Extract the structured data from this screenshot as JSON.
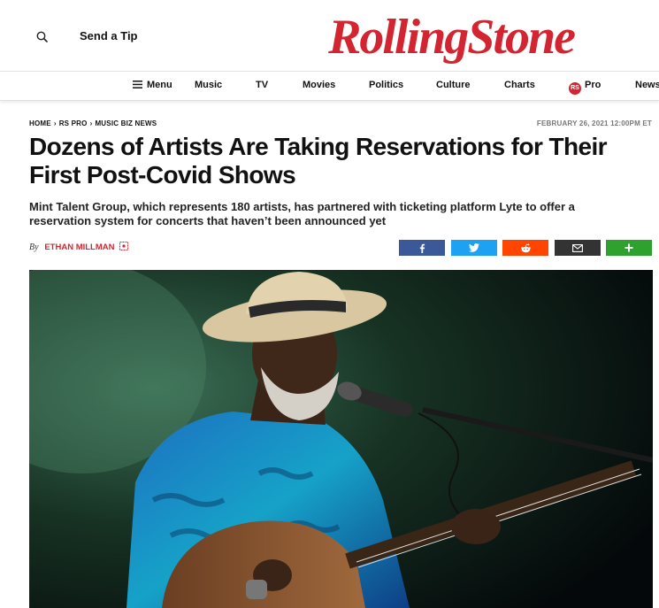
{
  "header": {
    "send_tip": "Send a Tip",
    "logo_text": "RollingStone"
  },
  "nav": {
    "menu": "Menu",
    "music": "Music",
    "tv": "TV",
    "movies": "Movies",
    "politics": "Politics",
    "culture": "Culture",
    "charts": "Charts",
    "pro_badge": "RS",
    "pro": "Pro",
    "news": "News"
  },
  "article": {
    "breadcrumb": [
      "HOME",
      "RS PRO",
      "MUSIC BIZ NEWS"
    ],
    "date": "FEBRUARY 26, 2021 12:00PM ET",
    "headline": "Dozens of Artists Are Taking Reservations for Their First Post-Covid Shows",
    "dek": "Mint Talent Group, which represents 180 artists, has partnered with ticketing platform Lyte to offer a reservation system for concerts that haven’t been announced yet",
    "by": "By",
    "author": "ETHAN MILLMAN"
  },
  "share": [
    "facebook-icon",
    "twitter-icon",
    "reddit-icon",
    "email-icon",
    "plus-icon"
  ],
  "colors": {
    "brand_red": "#d32531",
    "facebook": "#3b5998",
    "twitter": "#1da1f2",
    "reddit": "#ff4500",
    "email": "#333333",
    "more": "#2ea12e"
  }
}
